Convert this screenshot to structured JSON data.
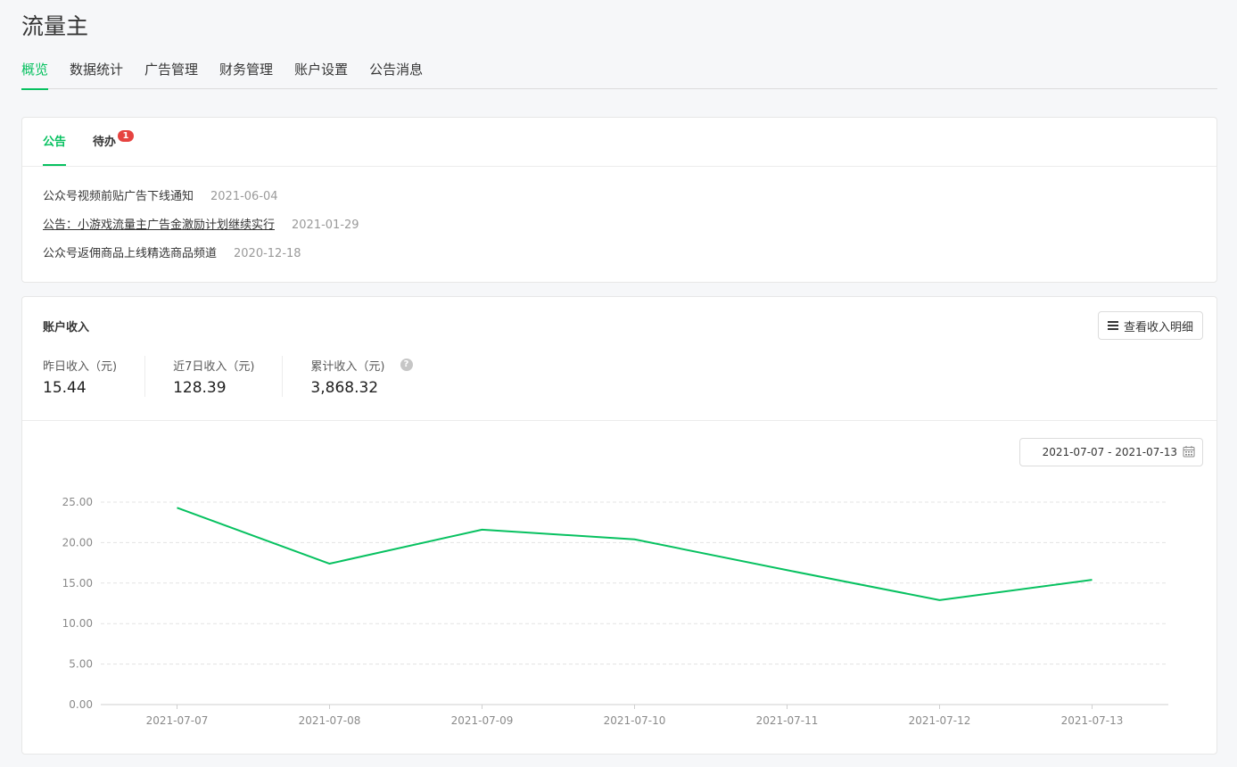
{
  "page": {
    "title": "流量主"
  },
  "nav": {
    "items": [
      {
        "label": "概览",
        "active": true
      },
      {
        "label": "数据统计"
      },
      {
        "label": "广告管理"
      },
      {
        "label": "财务管理"
      },
      {
        "label": "账户设置"
      },
      {
        "label": "公告消息"
      }
    ]
  },
  "notice_card": {
    "tabs": [
      {
        "label": "公告",
        "active": true
      },
      {
        "label": "待办",
        "badge": "1"
      }
    ],
    "notices": [
      {
        "title": "公众号视频前贴广告下线通知",
        "date": "2021-06-04"
      },
      {
        "title": "公告：小游戏流量主广告金激励计划继续实行",
        "date": "2021-01-29",
        "underline": true
      },
      {
        "title": "公众号返佣商品上线精选商品频道",
        "date": "2020-12-18"
      }
    ]
  },
  "income": {
    "title": "账户收入",
    "detail_button": "查看收入明细",
    "stats": [
      {
        "label": "昨日收入（元)",
        "value": "15.44"
      },
      {
        "label": "近7日收入（元)",
        "value": "128.39"
      },
      {
        "label": "累计收入（元)",
        "value": "3,868.32",
        "help": "?"
      }
    ],
    "date_range": "2021-07-07 - 2021-07-13"
  },
  "colors": {
    "accent": "#07c160",
    "badge": "#e64340"
  },
  "chart_data": {
    "type": "line",
    "x": [
      "2021-07-07",
      "2021-07-08",
      "2021-07-09",
      "2021-07-10",
      "2021-07-11",
      "2021-07-12",
      "2021-07-13"
    ],
    "series": [
      {
        "values": [
          24.3,
          17.4,
          21.6,
          20.4,
          16.6,
          12.9,
          15.4
        ],
        "color": "#07c160"
      }
    ],
    "yticks": [
      "0.00",
      "5.00",
      "10.00",
      "15.00",
      "20.00",
      "25.00"
    ],
    "ylim": [
      0,
      25
    ],
    "grid": true
  }
}
